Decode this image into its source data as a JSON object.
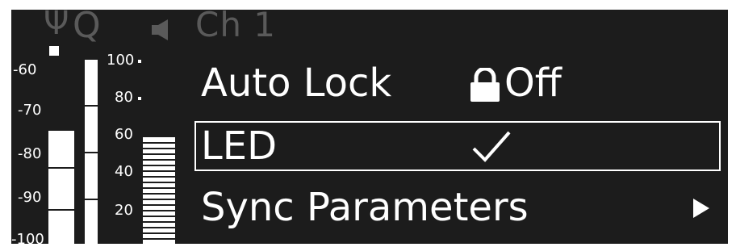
{
  "status_bar": {
    "antenna_symbol": "Ψ",
    "quality_symbol": "Q",
    "speaker_icon": "speaker-icon",
    "channel": "Ch 1"
  },
  "rf_meter": {
    "scale": [
      "-60",
      "-70",
      "-80",
      "-90",
      "-100"
    ],
    "level_fraction": 0.62
  },
  "af_meter": {
    "scale": [
      "100",
      "80",
      "60",
      "40",
      "20"
    ],
    "peak_fraction": 1.0,
    "level_fraction": 0.58
  },
  "menu": {
    "items": [
      {
        "label": "Auto Lock",
        "value": "Off",
        "icon": "lock-icon"
      },
      {
        "label": "LED",
        "value_icon": "check-icon",
        "selected": true
      },
      {
        "label": "Sync Parameters",
        "value_icon": "arrow-right-icon"
      }
    ]
  },
  "colors": {
    "background": "#1c1c1c",
    "foreground": "#ffffff",
    "dim": "#5a5a5a"
  }
}
